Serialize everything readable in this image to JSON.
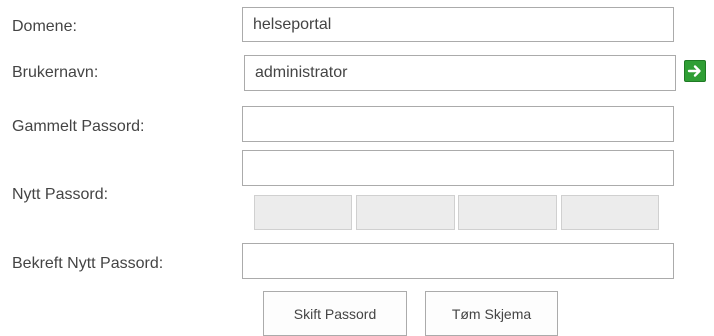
{
  "form": {
    "domain": {
      "label": "Domene:",
      "value": "helseportal"
    },
    "username": {
      "label": "Brukernavn:",
      "value": "administrator",
      "go_icon": "arrow-right-icon",
      "go_color": "#2f9e34"
    },
    "old_password": {
      "label": "Gammelt Passord:",
      "value": ""
    },
    "new_password": {
      "label": "Nytt Passord:",
      "value": ""
    },
    "confirm_password": {
      "label": "Bekreft Nytt Passord:",
      "value": ""
    }
  },
  "buttons": {
    "change_password": "Skift Passord",
    "clear_form": "Tøm Skjema"
  }
}
